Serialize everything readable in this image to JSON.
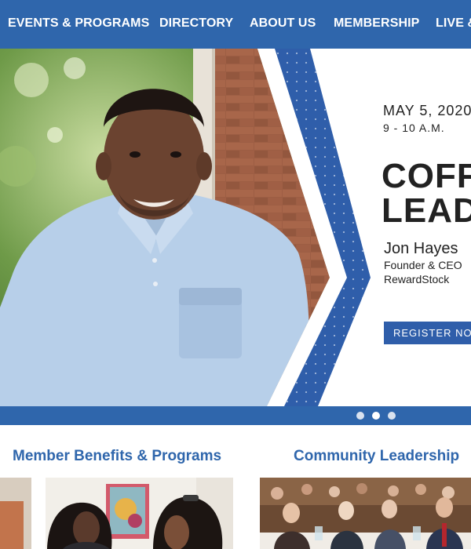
{
  "nav": {
    "items": [
      "EVENTS & PROGRAMS",
      "DIRECTORY",
      "ABOUT US",
      "MEMBERSHIP",
      "LIVE &"
    ]
  },
  "hero": {
    "date": "MAY 5, 2020",
    "time": "9 - 10 A.M.",
    "title_line1": "COFF",
    "title_line2": "LEAD",
    "speaker_name": "Jon Hayes",
    "speaker_role": "Founder & CEO",
    "speaker_company": "RewardStock",
    "cta_label": "REGISTER NOW",
    "accent_color": "#2f5eaa"
  },
  "carousel": {
    "slide_count": 3,
    "active_index": 1
  },
  "sections": [
    {
      "title": "Member Benefits & Programs"
    },
    {
      "title": "Community Leadership"
    }
  ],
  "icons": {
    "carousel_dot": "circle"
  },
  "colors": {
    "nav_bg": "#2f66ac",
    "heading_blue": "#2f66ac",
    "button_bg": "#2f5eaa"
  }
}
